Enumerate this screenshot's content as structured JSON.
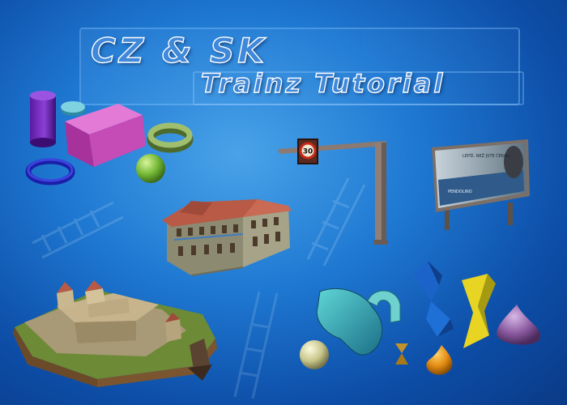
{
  "banner": {
    "title": "CZ & SK",
    "subtitle": "Trainz Tutorial"
  },
  "speed_sign": {
    "value": "30"
  },
  "billboard": {
    "headline": "LEPŠÍ, NEŽ JSTE ČEKALI",
    "brand": "PENDOLINO"
  },
  "palette": {
    "background": "#1f79d2",
    "title_fill": "#3f88da",
    "title_outline": "#ffffff"
  }
}
